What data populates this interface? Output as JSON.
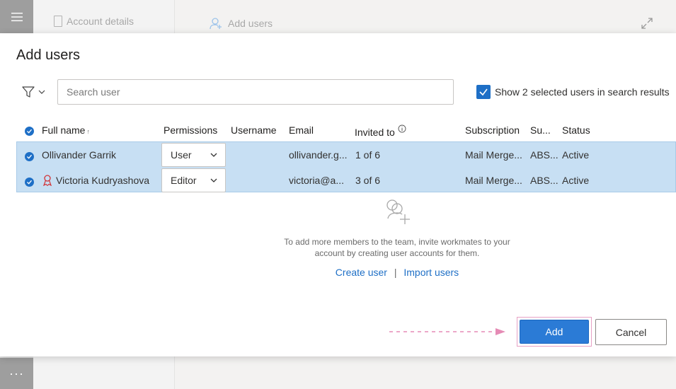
{
  "background": {
    "menu_icon": "hamburger-icon",
    "more_label": "···",
    "account_details": "Account details",
    "add_users_tab": "Add users"
  },
  "dialog": {
    "title": "Add users",
    "search": {
      "placeholder": "Search user",
      "value": ""
    },
    "show_selected": {
      "label": "Show 2 selected users in search results",
      "checked": true
    },
    "columns": {
      "full_name": "Full name",
      "sort_indicator": "↑",
      "permissions": "Permissions",
      "username": "Username",
      "email": "Email",
      "invited_to": "Invited to",
      "subscription": "Subscription",
      "su": "Su...",
      "status": "Status"
    },
    "rows": [
      {
        "name": "Ollivander Garrik",
        "permission": "User",
        "username": "",
        "email": "ollivander.g...",
        "invited": "1 of 6",
        "subscription": "Mail Merge...",
        "su": "ABS...",
        "status": "Active",
        "selected": true,
        "owner": false
      },
      {
        "name": "Victoria Kudryashova",
        "permission": "Editor",
        "username": "",
        "email": "victoria@a...",
        "invited": "3 of 6",
        "subscription": "Mail Merge...",
        "su": "ABS...",
        "status": "Active",
        "selected": true,
        "owner": true
      }
    ],
    "empty_state": {
      "text": "To add more members to the team, invite workmates to your account by creating user accounts for them.",
      "create_user": "Create user",
      "separator": "|",
      "import_users": "Import users"
    },
    "buttons": {
      "add": "Add",
      "cancel": "Cancel"
    }
  },
  "colors": {
    "accent": "#2b7bd6",
    "selection": "#c7dff3",
    "owner_icon": "#d13438",
    "highlight": "#e7a1c4"
  }
}
